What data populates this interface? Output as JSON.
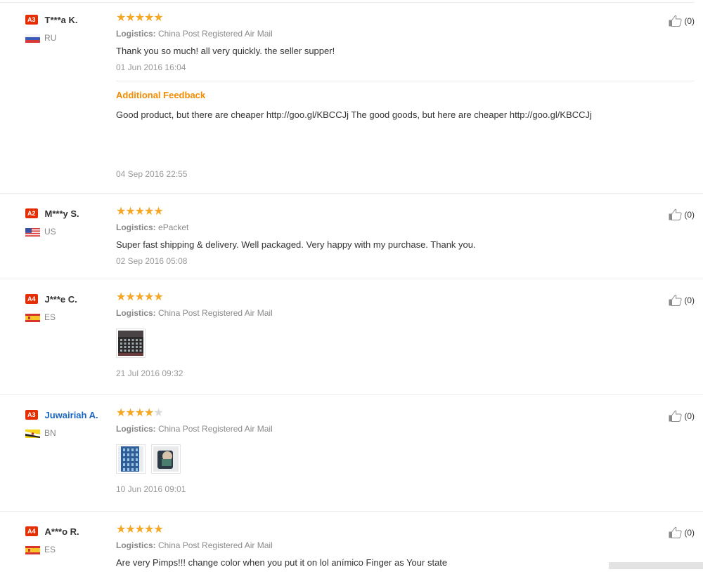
{
  "reviews": [
    {
      "level": "A3",
      "name": "T***a K.",
      "name_is_link": false,
      "country": "RU",
      "flag": "ru",
      "rating": 5,
      "logistics_label": "Logistics:",
      "logistics": "China Post Registered Air Mail",
      "text": "Thank you so much! all very quickly. the seller supper!",
      "date": "01 Jun 2016 16:04",
      "additional": {
        "title": "Additional Feedback",
        "text": "Good product, but there are cheaper http://goo.gl/KBCCJj The good goods, but here are cheaper http://goo.gl/KBCCJj",
        "date": "04 Sep 2016 22:55"
      },
      "helpful": "(0)"
    },
    {
      "level": "A2",
      "name": "M***y S.",
      "name_is_link": false,
      "country": "US",
      "flag": "us",
      "rating": 5,
      "logistics_label": "Logistics:",
      "logistics": "ePacket",
      "text": "Super fast shipping & delivery. Well packaged. Very happy with my purchase. Thank you.",
      "date": "02 Sep 2016 05:08",
      "helpful": "(0)"
    },
    {
      "level": "A4",
      "name": "J***e C.",
      "name_is_link": false,
      "country": "ES",
      "flag": "es",
      "rating": 5,
      "logistics_label": "Logistics:",
      "logistics": "China Post Registered Air Mail",
      "photos": [
        "product-photo"
      ],
      "date": "21 Jul 2016 09:32",
      "helpful": "(0)"
    },
    {
      "level": "A3",
      "name": "Juwairiah A.",
      "name_is_link": true,
      "country": "BN",
      "flag": "bn",
      "rating": 4,
      "logistics_label": "Logistics:",
      "logistics": "China Post Registered Air Mail",
      "photos": [
        "product-photo",
        "product-photo"
      ],
      "date": "10 Jun 2016 09:01",
      "helpful": "(0)"
    },
    {
      "level": "A4",
      "name": "A***o R.",
      "name_is_link": false,
      "country": "ES",
      "flag": "es",
      "rating": 5,
      "logistics_label": "Logistics:",
      "logistics": "China Post Registered Air Mail",
      "text": "Are very Pimps!!! change color when you put it on lol anímico Finger as Your state",
      "helpful": "(0)"
    }
  ],
  "colors": {
    "level_badge": "#e62e04",
    "star": "#f5a623",
    "star_empty": "#d9d9d9",
    "additional_title": "#f58c00",
    "buyer_link": "#1a66c4"
  },
  "icons": {
    "helpful": "thumbs-up-icon",
    "star": "star-icon"
  }
}
